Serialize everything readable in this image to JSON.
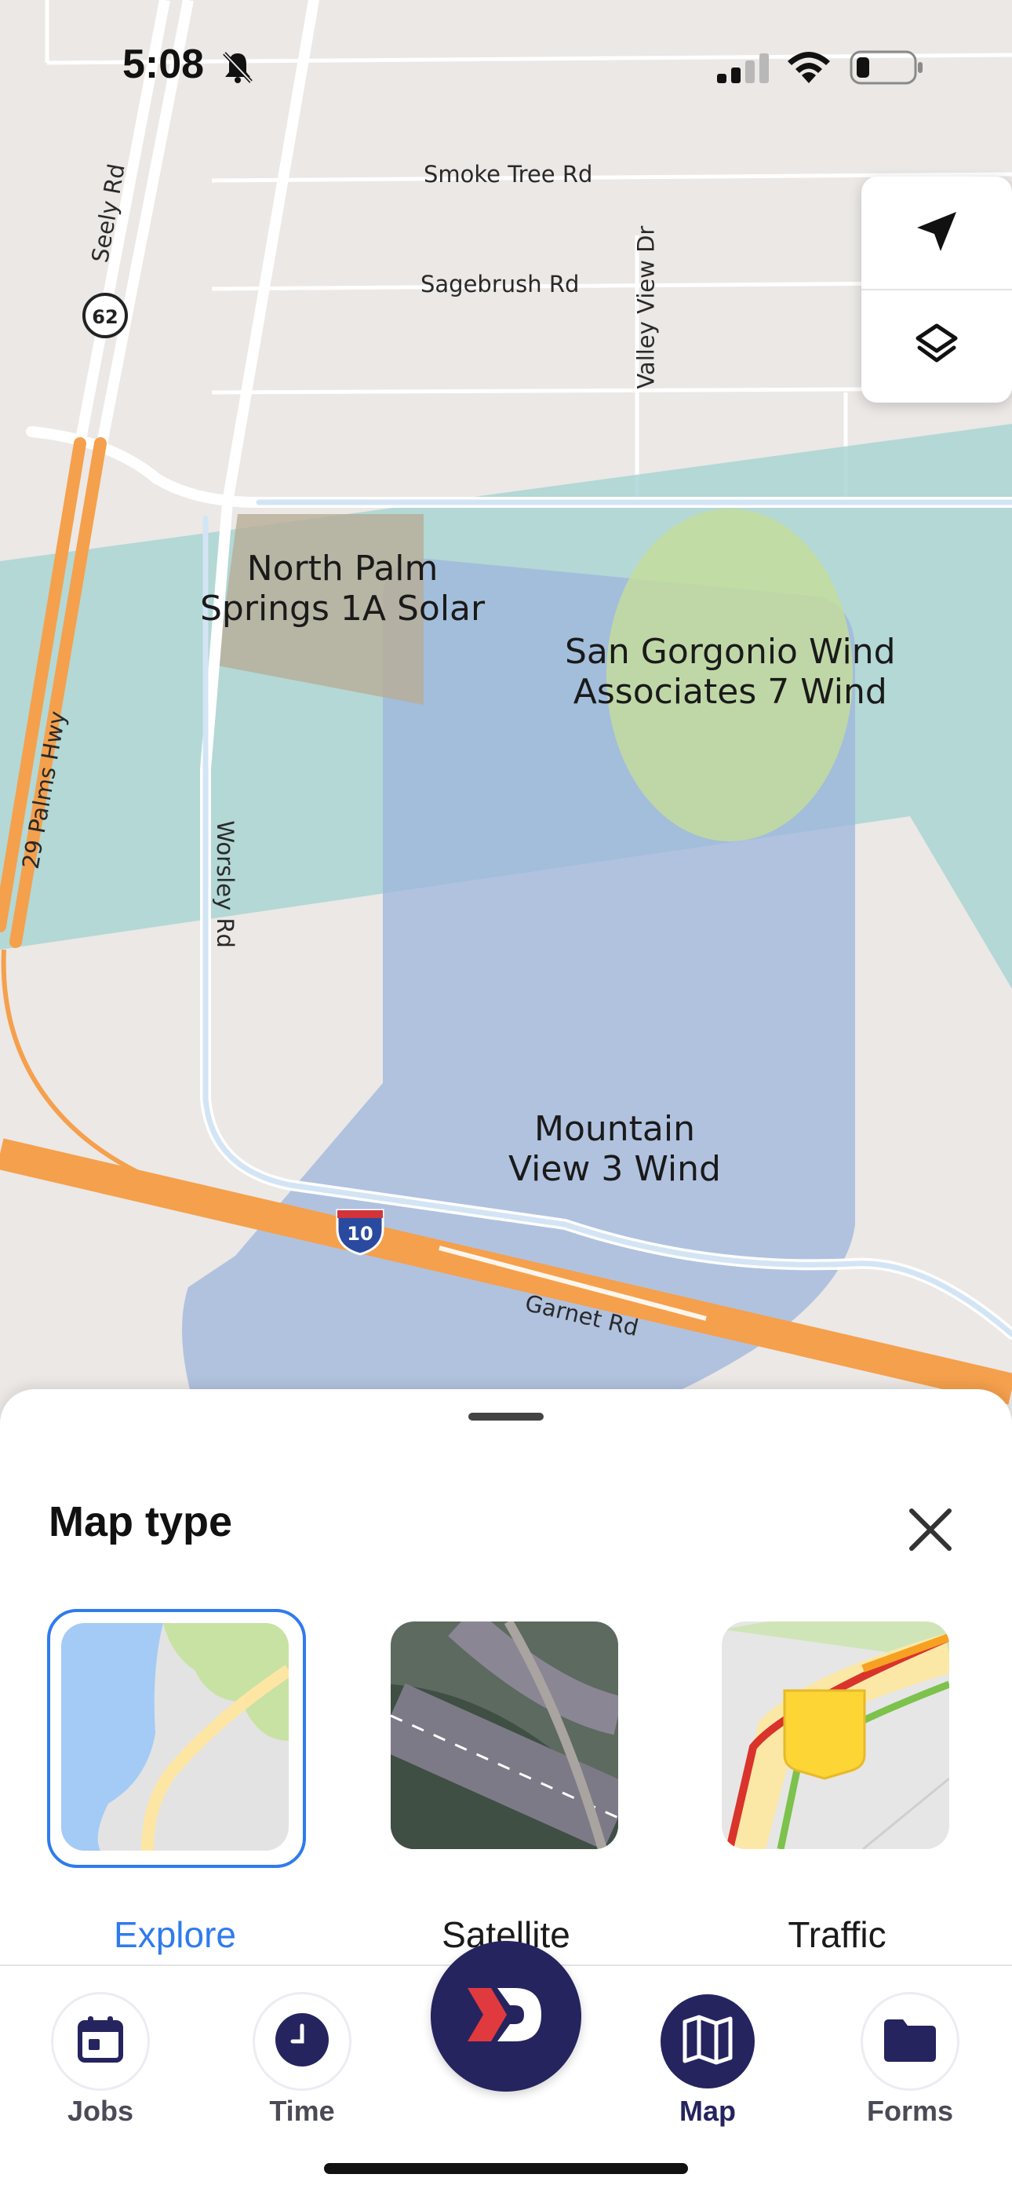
{
  "status_bar": {
    "time": "5:08",
    "icons": [
      "bell-slash-icon",
      "signal-icon",
      "wifi-icon",
      "battery-icon"
    ]
  },
  "map": {
    "roads": {
      "smoke_tree": "Smoke Tree Rd",
      "sagebrush": "Sagebrush Rd",
      "valley_view": "Valley View Dr",
      "seely": "Seely Rd",
      "palms_hwy": "29 Palms Hwy",
      "worsley": "Worsley Rd",
      "garnet": "Garnet Rd"
    },
    "shields": {
      "route_62": "62",
      "interstate_10": "10"
    },
    "areas": {
      "north_palm": "North Palm\nSprings 1A Solar",
      "san_gorgonio": "San Gorgonio Wind\nAssociates 7 Wind",
      "mountain_view": "Mountain\nView 3 Wind"
    },
    "controls": [
      "location-arrow-icon",
      "layers-icon"
    ]
  },
  "sheet": {
    "title": "Map type",
    "options": [
      {
        "label": "Explore",
        "selected": true
      },
      {
        "label": "Satellite",
        "selected": false
      },
      {
        "label": "Traffic",
        "selected": false
      }
    ]
  },
  "tabbar": {
    "tabs": [
      {
        "label": "Jobs",
        "active": false
      },
      {
        "label": "Time",
        "active": false
      },
      {
        "label": "Map",
        "active": true
      },
      {
        "label": "Forms",
        "active": false
      }
    ]
  },
  "colors": {
    "accent_blue": "#2f7bed",
    "brand_navy": "#25245f",
    "brand_red": "#e03a3e",
    "highway_orange": "#f5a04c",
    "teal_area": "#a5d3d2",
    "blue_area": "#a4bde0",
    "green_area": "#c2d99a"
  }
}
